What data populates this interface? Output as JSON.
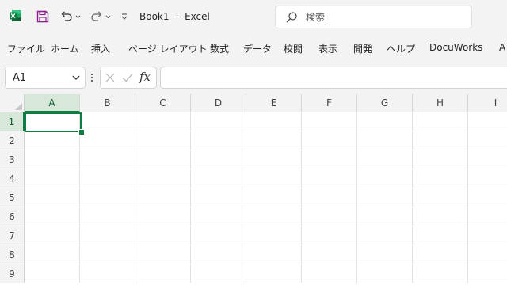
{
  "titlebar": {
    "doc_title": "Book1  -  Excel",
    "search_placeholder": "検索"
  },
  "ribbon": {
    "tabs": [
      "ファイル",
      "ホーム",
      "挿入",
      "ページ レイアウト",
      "数式",
      "データ",
      "校閲",
      "表示",
      "開発",
      "ヘルプ",
      "DocuWorks",
      "A"
    ]
  },
  "formula_bar": {
    "name_box": "A1",
    "fx_label": "fx",
    "formula_value": ""
  },
  "grid": {
    "columns": [
      "A",
      "B",
      "C",
      "D",
      "E",
      "F",
      "G",
      "H",
      "I"
    ],
    "rows": [
      "1",
      "2",
      "3",
      "4",
      "5",
      "6",
      "7",
      "8",
      "9"
    ],
    "active_cell": "A1"
  },
  "colors": {
    "excel_green": "#107c41",
    "header_highlight": "#d7e8db",
    "save_purple": "#8b1f8e",
    "window_bg": "#f3f3f3"
  }
}
